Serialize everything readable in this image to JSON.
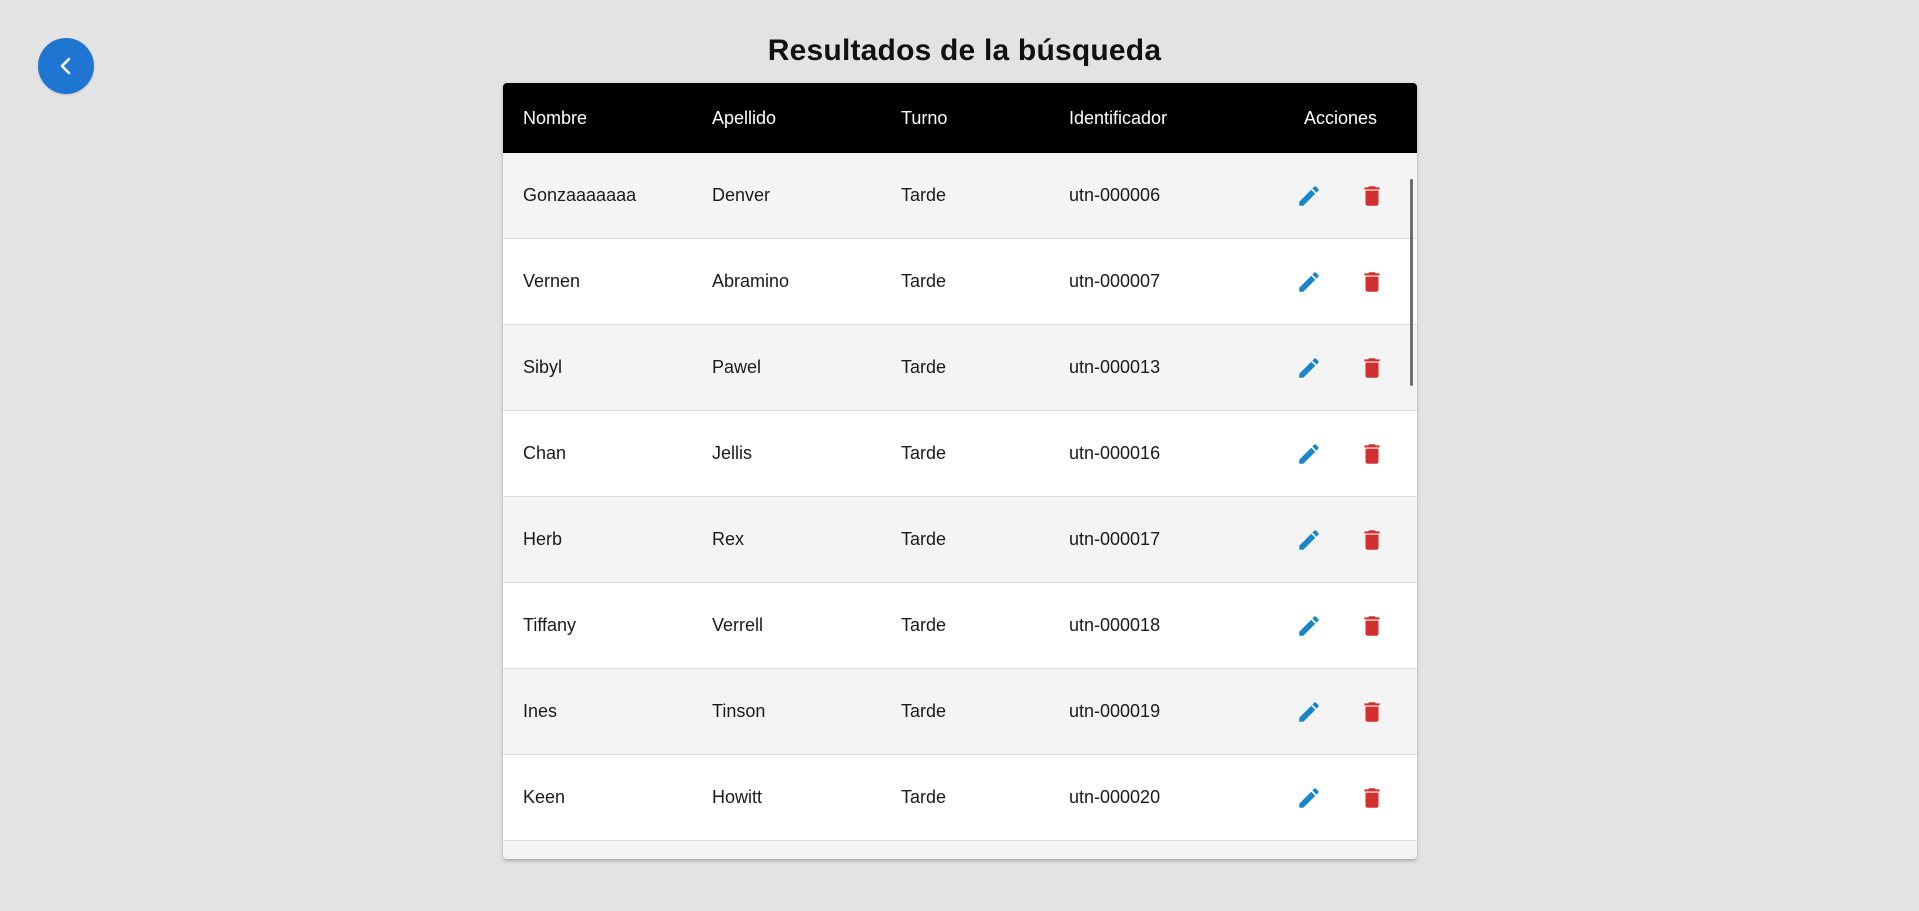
{
  "page": {
    "title": "Resultados de la búsqueda"
  },
  "colors": {
    "accent": "#1f76d2",
    "edit": "#1a85c9",
    "delete": "#d32f2f",
    "header_bg": "#000000"
  },
  "back_button": {
    "icon": "chevron-left-icon"
  },
  "table": {
    "columns": [
      "Nombre",
      "Apellido",
      "Turno",
      "Identificador",
      "Acciones"
    ],
    "rows": [
      {
        "nombre": "Gonzaaaaaaa",
        "apellido": "Denver",
        "turno": "Tarde",
        "identificador": "utn-000006"
      },
      {
        "nombre": "Vernen",
        "apellido": "Abramino",
        "turno": "Tarde",
        "identificador": "utn-000007"
      },
      {
        "nombre": "Sibyl",
        "apellido": "Pawel",
        "turno": "Tarde",
        "identificador": "utn-000013"
      },
      {
        "nombre": "Chan",
        "apellido": "Jellis",
        "turno": "Tarde",
        "identificador": "utn-000016"
      },
      {
        "nombre": "Herb",
        "apellido": "Rex",
        "turno": "Tarde",
        "identificador": "utn-000017"
      },
      {
        "nombre": "Tiffany",
        "apellido": "Verrell",
        "turno": "Tarde",
        "identificador": "utn-000018"
      },
      {
        "nombre": "Ines",
        "apellido": "Tinson",
        "turno": "Tarde",
        "identificador": "utn-000019"
      },
      {
        "nombre": "Keen",
        "apellido": "Howitt",
        "turno": "Tarde",
        "identificador": "utn-000020"
      }
    ],
    "action_icons": [
      "pencil-icon",
      "trash-icon"
    ]
  }
}
